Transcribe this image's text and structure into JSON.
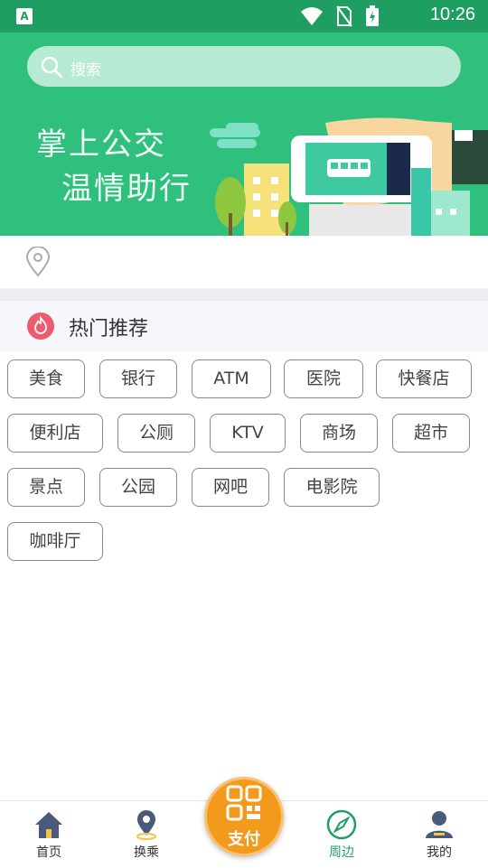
{
  "status_bar": {
    "app_badge": "A",
    "time": "10:26"
  },
  "search": {
    "placeholder": "搜索"
  },
  "banner": {
    "line1": "掌上公交",
    "line2": "温情助行"
  },
  "hot": {
    "title": "热门推荐",
    "tags": [
      "美食",
      "银行",
      "ATM",
      "医院",
      "快餐店",
      "便利店",
      "公厕",
      "KTV",
      "商场",
      "超市",
      "景点",
      "公园",
      "网吧",
      "电影院",
      "咖啡厅"
    ]
  },
  "nav": {
    "items": [
      {
        "label": "首页",
        "icon": "home-icon"
      },
      {
        "label": "换乘",
        "icon": "transfer-icon"
      },
      {
        "label": "周边",
        "icon": "compass-icon",
        "active": true
      },
      {
        "label": "我的",
        "icon": "user-icon"
      }
    ],
    "pay_label": "支付"
  },
  "colors": {
    "primary": "#1f9e61",
    "hero": "#2fc07e",
    "pay": "#f39a1c",
    "fire": "#ee5b6f"
  }
}
